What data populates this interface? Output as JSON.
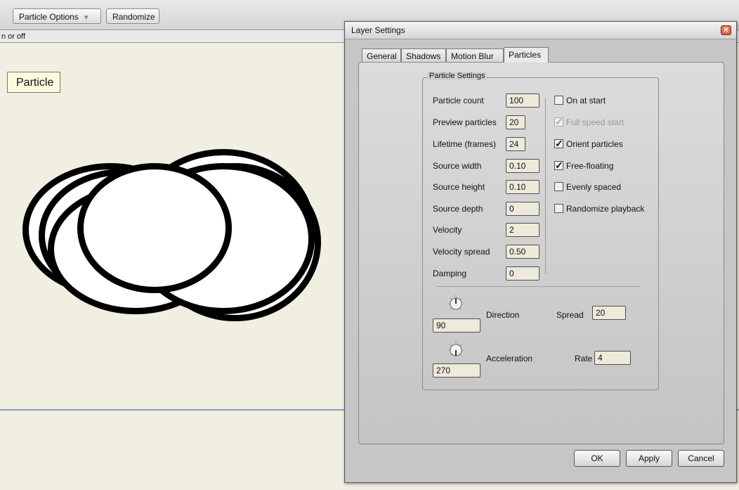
{
  "toolbar": {
    "particle_options": "Particle Options",
    "randomize": "Randomize"
  },
  "hint": "n or off",
  "canvas": {
    "tooltip": "Particle"
  },
  "dialog": {
    "title": "Layer Settings",
    "tabs": [
      "General",
      "Shadows",
      "Motion Blur",
      "Particles"
    ],
    "active_tab": "Particles",
    "group_title": "Particle Settings",
    "fields": [
      {
        "label": "Particle count",
        "value": "100"
      },
      {
        "label": "Preview particles",
        "value": "20"
      },
      {
        "label": "Lifetime (frames)",
        "value": "24"
      },
      {
        "label": "Source width",
        "value": "0.10"
      },
      {
        "label": "Source height",
        "value": "0.10"
      },
      {
        "label": "Source depth",
        "value": "0"
      },
      {
        "label": "Velocity",
        "value": "2"
      },
      {
        "label": "Velocity spread",
        "value": "0.50"
      },
      {
        "label": "Damping",
        "value": "0"
      }
    ],
    "checkboxes": [
      {
        "label": "On at start",
        "checked": false,
        "enabled": true
      },
      {
        "label": "Full speed start",
        "checked": true,
        "enabled": false
      },
      {
        "label": "Orient particles",
        "checked": true,
        "enabled": true
      },
      {
        "label": "Free-floating",
        "checked": true,
        "enabled": true
      },
      {
        "label": "Evenly spaced",
        "checked": false,
        "enabled": true
      },
      {
        "label": "Randomize playback",
        "checked": false,
        "enabled": true
      }
    ],
    "direction": {
      "value": "90",
      "label": "Direction",
      "spread_label": "Spread",
      "spread_value": "20"
    },
    "acceleration": {
      "value": "270",
      "label": "Acceleration",
      "rate_label": "Rate",
      "rate_value": "4"
    },
    "buttons": {
      "ok": "OK",
      "apply": "Apply",
      "cancel": "Cancel"
    }
  }
}
